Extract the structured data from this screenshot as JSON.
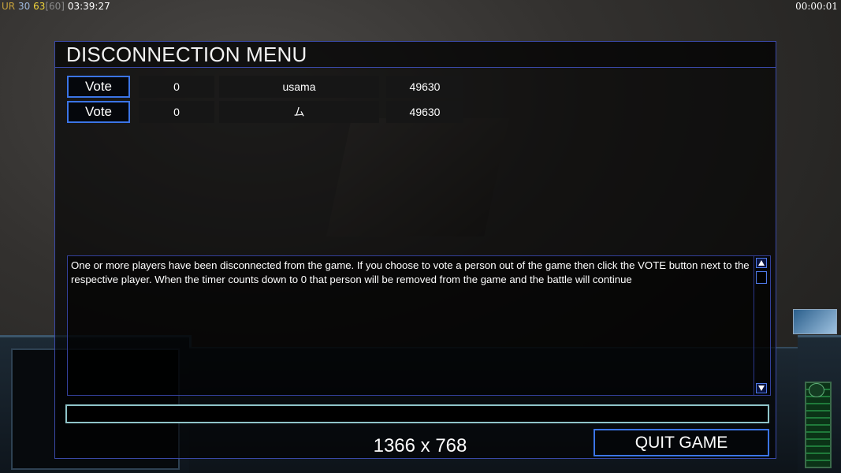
{
  "hud": {
    "label": "UR",
    "value1": "30",
    "value2": "63",
    "value3": "[60]",
    "time": "03:39:27",
    "clock": "00:00:01"
  },
  "dialog": {
    "title": "DISCONNECTION MENU",
    "players": [
      {
        "vote_label": "Vote",
        "votes": "0",
        "name": "usama",
        "timer": "49630"
      },
      {
        "vote_label": "Vote",
        "votes": "0",
        "name": "ム",
        "timer": "49630"
      }
    ],
    "message": "One or more players have been disconnected from the game. If you choose to vote a person out of the game then click the VOTE button next to the respective player. When the timer counts down to 0 that person will be removed from the game and the battle will continue",
    "chat_value": "",
    "resolution": "1366 x 768",
    "quit_label": "QUIT GAME"
  },
  "colors": {
    "button_border": "#3b74e6",
    "dialog_border": "#3a49a8",
    "chat_border": "#8fc4c9"
  }
}
